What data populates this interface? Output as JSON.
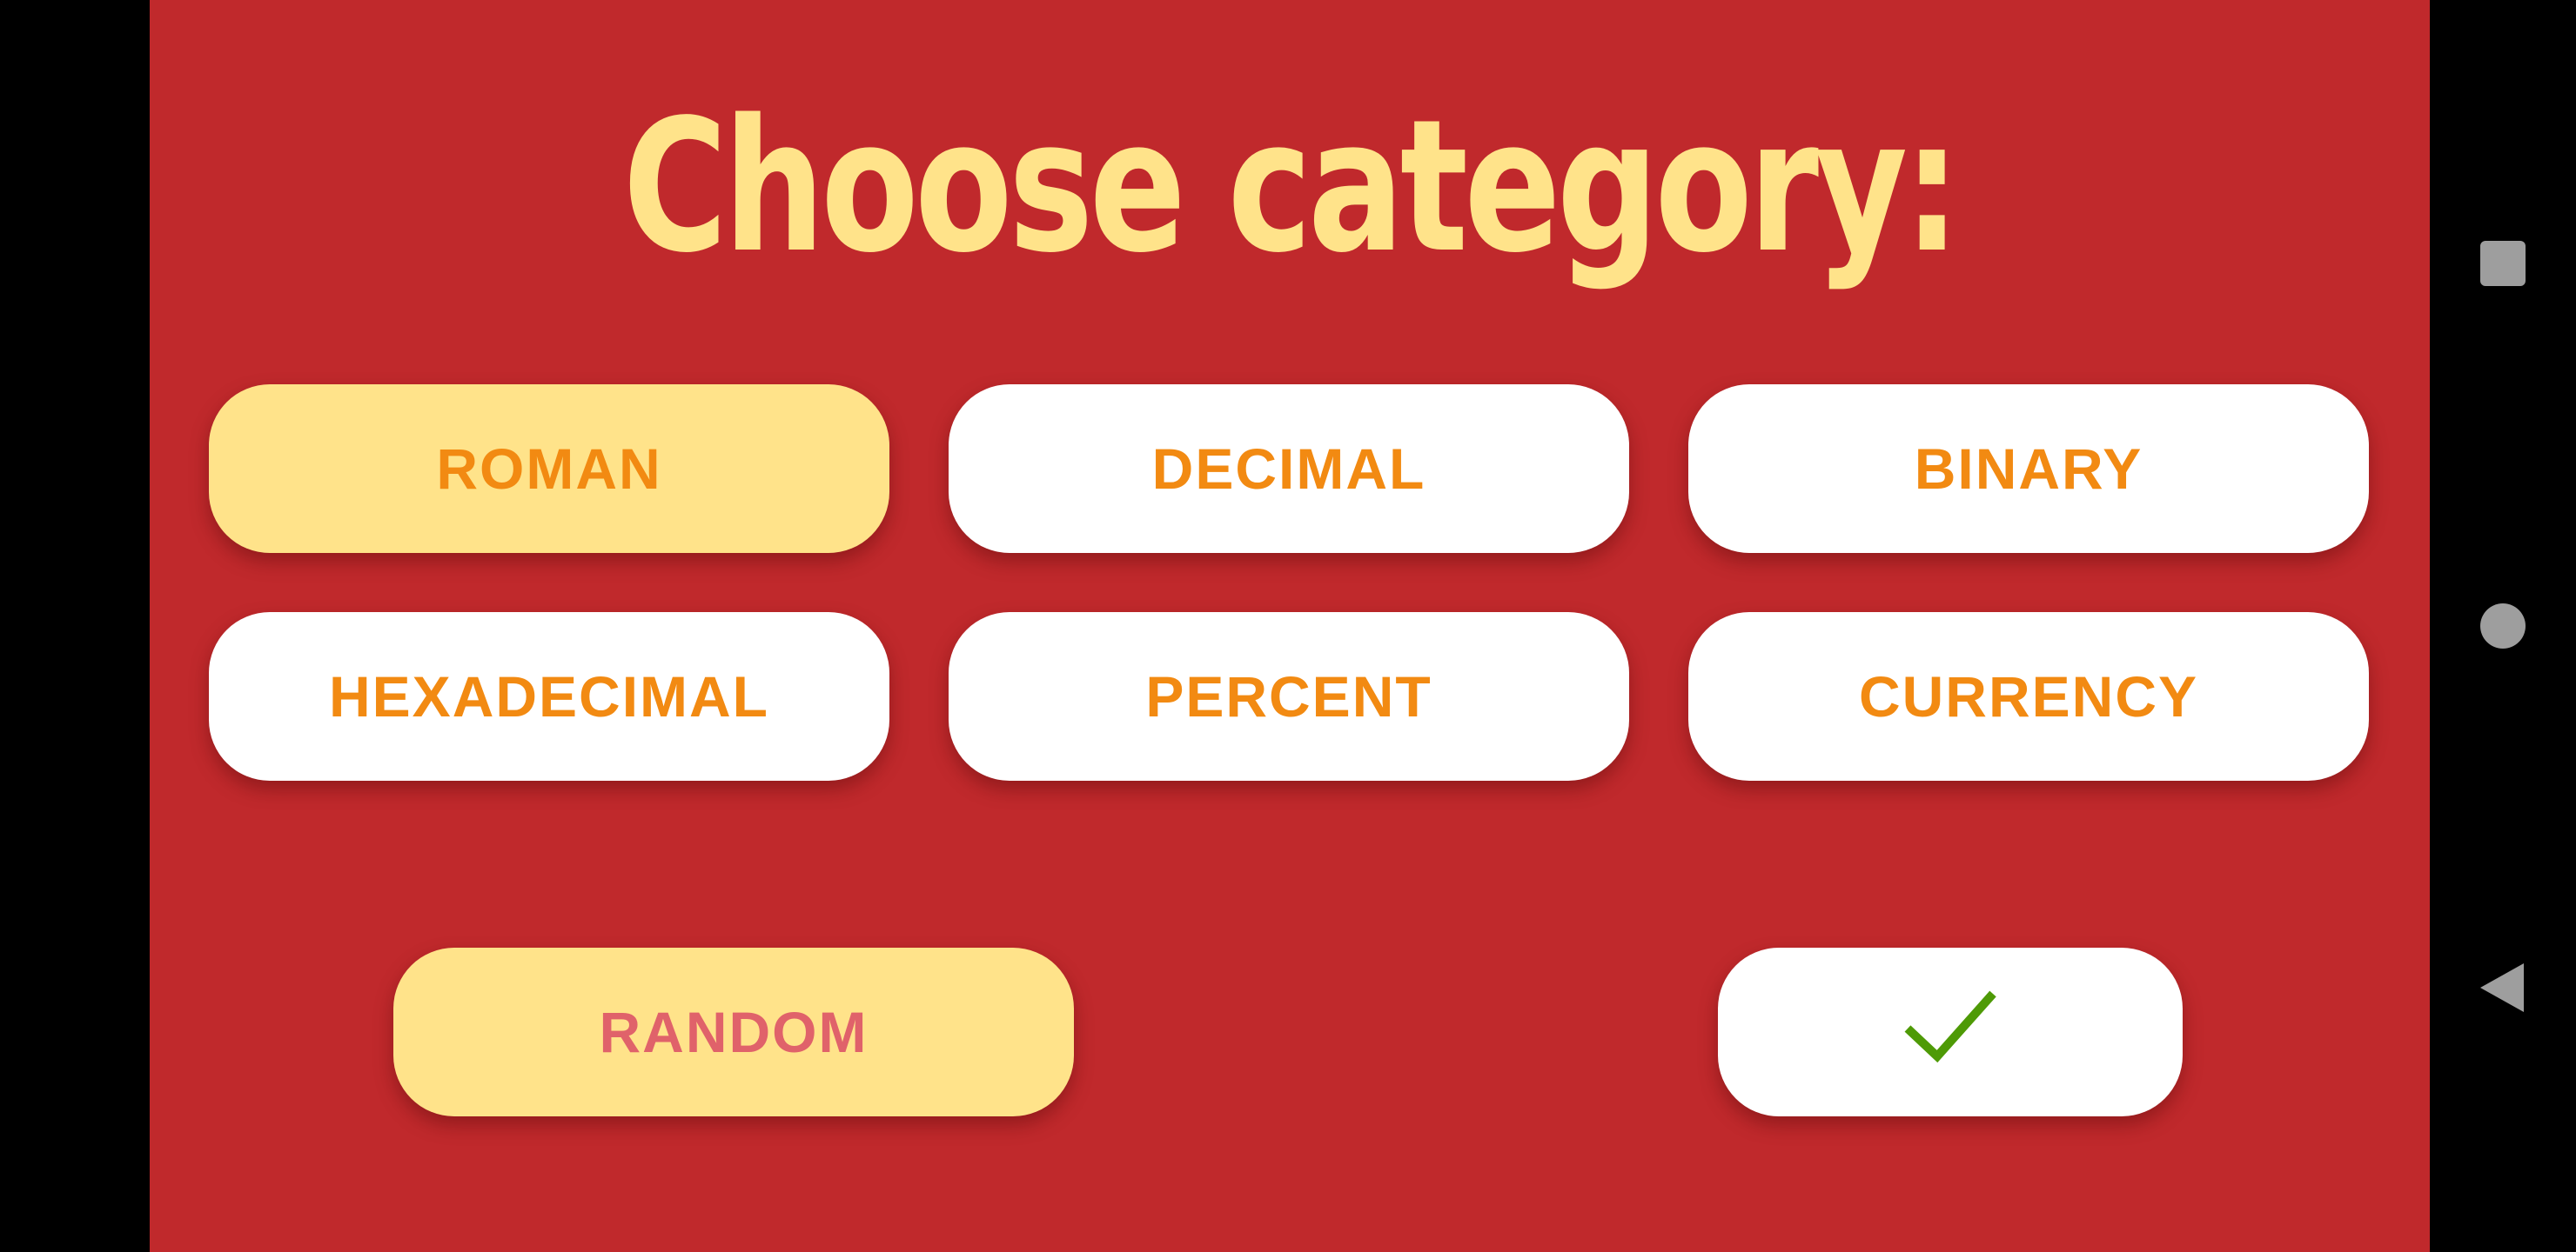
{
  "title": "Choose category:",
  "categories": [
    {
      "label": "ROMAN",
      "selected": true
    },
    {
      "label": "DECIMAL",
      "selected": false
    },
    {
      "label": "BINARY",
      "selected": false
    },
    {
      "label": "HEXADECIMAL",
      "selected": false
    },
    {
      "label": "PERCENT",
      "selected": false
    },
    {
      "label": "CURRENCY",
      "selected": false
    }
  ],
  "actions": {
    "random_label": "RANDOM",
    "confirm_icon": "checkmark-icon"
  },
  "system_nav": {
    "recents_icon": "square-icon",
    "home_icon": "circle-icon",
    "back_icon": "triangle-back-icon"
  },
  "colors": {
    "background": "#c0292c",
    "title": "#ffe38a",
    "button": "#ffffff",
    "button_selected": "#ffe38a",
    "button_text": "#f28a12",
    "random_text": "#e0626a",
    "check": "#4e9a06",
    "nav_icon": "#9e9e9e"
  }
}
